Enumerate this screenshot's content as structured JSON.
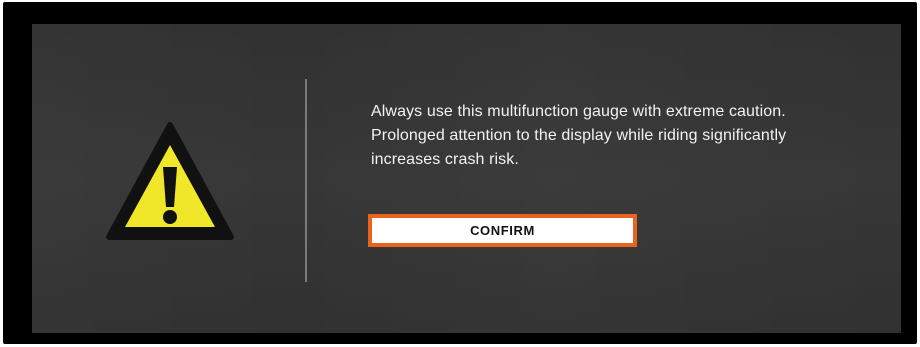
{
  "dialog": {
    "message": "Always use this multifunction gauge with extreme caution.\nProlonged attention to the display while riding significantly\nincreases crash risk.",
    "confirm_label": "CONFIRM"
  },
  "icons": {
    "warning": "warning-triangle-exclamation"
  },
  "colors": {
    "screen_background": "#343434",
    "bezel": "#000000",
    "warning_fill": "#f0e62a",
    "warning_outline": "#111111",
    "button_border": "#e8641e",
    "button_background": "#ffffff",
    "text": "#f2f2f2",
    "divider": "#7a7a7a"
  }
}
